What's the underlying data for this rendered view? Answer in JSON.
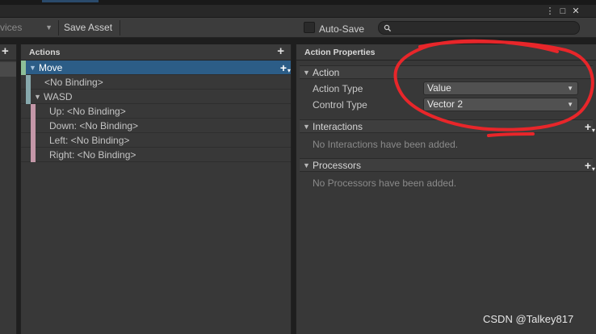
{
  "window": {
    "buttons": {
      "menu": "⋮",
      "maximize": "□",
      "close": "✕"
    }
  },
  "toolbar": {
    "devices_label": "vices",
    "save_asset": "Save Asset",
    "auto_save_label": "Auto-Save",
    "auto_save_checked": false,
    "search_icon": "🔍"
  },
  "left_pane": {
    "add_glyph": "+"
  },
  "actions_pane": {
    "title": "Actions",
    "add_glyph": "+",
    "rows": {
      "move": "Move",
      "no_binding": "<No Binding>",
      "wasd": "WASD",
      "up": "Up: <No Binding>",
      "down": "Down: <No Binding>",
      "left": "Left: <No Binding>",
      "right": "Right: <No Binding>"
    }
  },
  "properties_pane": {
    "title": "Action Properties",
    "action_section": "Action",
    "action_type_label": "Action Type",
    "action_type_value": "Value",
    "control_type_label": "Control Type",
    "control_type_value": "Vector 2",
    "interactions_section": "Interactions",
    "interactions_empty": "No Interactions have been added.",
    "processors_section": "Processors",
    "processors_empty": "No Processors have been added."
  },
  "watermark": "CSDN @Talkey817",
  "colors": {
    "selected_row": "#2c5d87",
    "action_map_bar": "#8dbf98",
    "binding_bar": "#87a9ad",
    "composite_part_bar": "#c497a8",
    "annotation_red": "#e8262a"
  },
  "icons": {
    "expand": "triangle-down-icon",
    "add": "plus-icon",
    "search": "magnifier-icon"
  }
}
